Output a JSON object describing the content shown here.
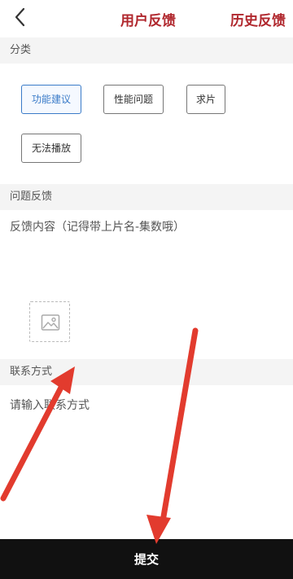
{
  "header": {
    "title": "用户反馈",
    "history_label": "历史反馈"
  },
  "category": {
    "label": "分类",
    "options": [
      "功能建议",
      "性能问题",
      "求片",
      "无法播放"
    ],
    "selected": "功能建议"
  },
  "feedback": {
    "label": "问题反馈",
    "placeholder": "反馈内容（记得带上片名-集数哦）"
  },
  "contact": {
    "label": "联系方式",
    "placeholder": "请输入联系方式"
  },
  "submit_label": "提交",
  "colors": {
    "accent_red": "#b0272d",
    "selected_blue": "#3a7bc8",
    "annotation_arrow": "#e23b2e"
  }
}
